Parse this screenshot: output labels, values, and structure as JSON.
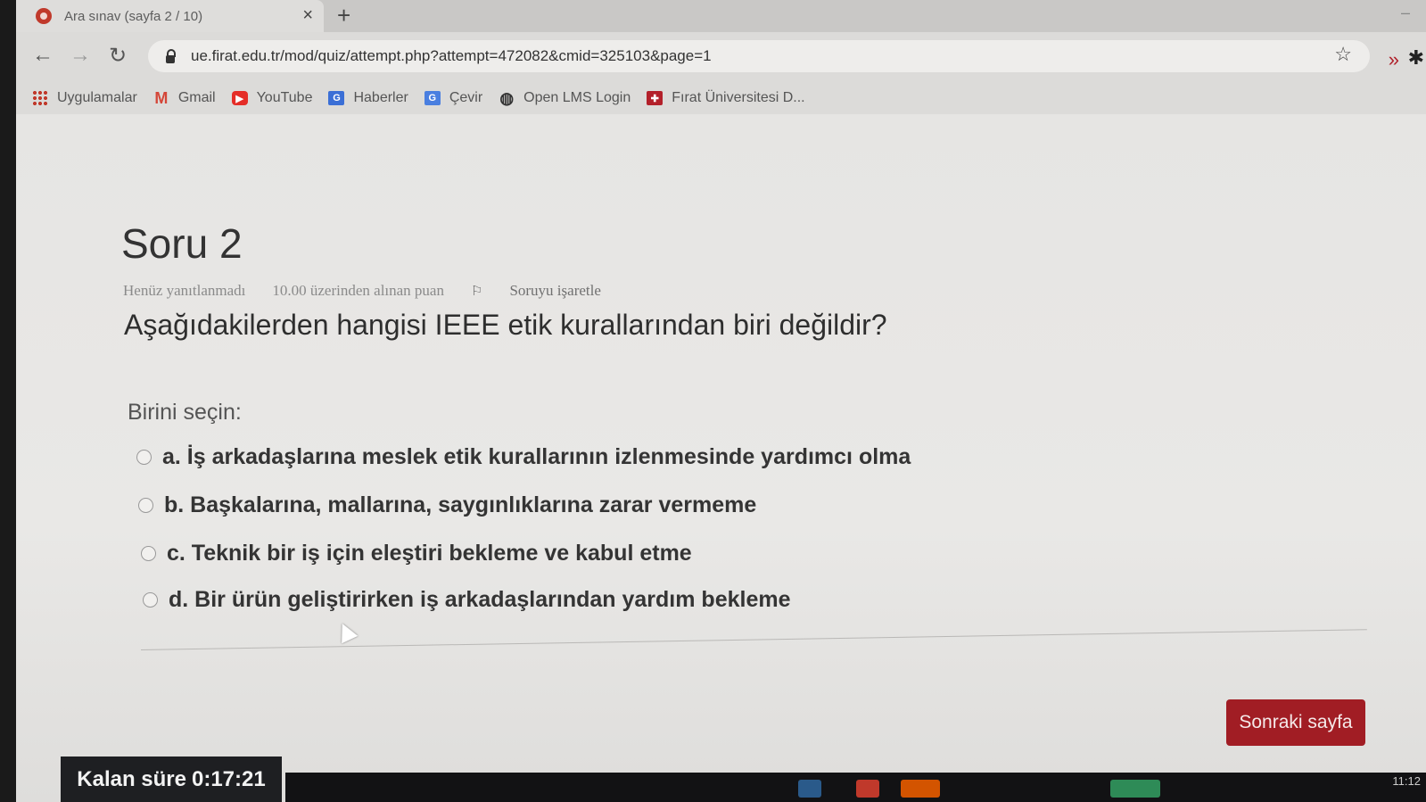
{
  "browser": {
    "tab_title": "Ara sınav (sayfa 2 / 10)",
    "tab_close": "×",
    "new_tab": "+",
    "url": "ue.firat.edu.tr/mod/quiz/attempt.php?attempt=472082&cmid=325103&page=1",
    "bookmarks": [
      {
        "label": "Uygulamalar",
        "icon": "apps-grid-icon"
      },
      {
        "label": "Gmail",
        "icon": "gmail-icon"
      },
      {
        "label": "YouTube",
        "icon": "youtube-icon"
      },
      {
        "label": "Haberler",
        "icon": "news-icon"
      },
      {
        "label": "Çevir",
        "icon": "translate-icon"
      },
      {
        "label": "Open LMS Login",
        "icon": "globe-icon"
      },
      {
        "label": "Fırat Üniversitesi D...",
        "icon": "firat-logo-icon"
      }
    ]
  },
  "quiz": {
    "title": "Soru 2",
    "status": "Henüz yanıtlanmadı",
    "points": "10.00 üzerinden alınan puan",
    "flag_label": "Soruyu işaretle",
    "question": "Aşağıdakilerden hangisi IEEE etik kurallarından biri değildir?",
    "prompt": "Birini seçin:",
    "answers": [
      "a. İş arkadaşlarına meslek etik kurallarının izlenmesinde yardımcı olma",
      "b. Başkalarına, mallarına, saygınlıklarına zarar vermeme",
      "c. Teknik bir iş için eleştiri bekleme ve kabul etme",
      "d. Bir ürün geliştirirken iş arkadaşlarından yardım bekleme"
    ],
    "next_button": "Sonraki sayfa",
    "timer_label": "Kalan süre",
    "timer_value": "0:17:21"
  },
  "taskbar": {
    "clock": "11:12"
  },
  "colors": {
    "accent": "#a11d24",
    "timer_bg": "#1e1f22"
  }
}
